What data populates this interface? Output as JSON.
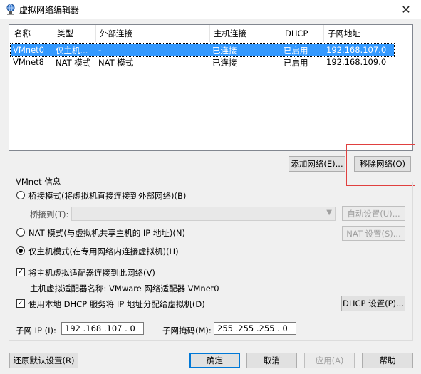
{
  "window": {
    "title": "虚拟网络编辑器",
    "icon": "vmware-network-icon",
    "close_glyph": "✕"
  },
  "table": {
    "columns": [
      "名称",
      "类型",
      "外部连接",
      "主机连接",
      "DHCP",
      "子网地址"
    ],
    "rows": [
      {
        "name": "VMnet0",
        "type": "仅主机...",
        "external": "-",
        "host": "已连接",
        "dhcp": "已启用",
        "subnet": "192.168.107.0",
        "selected": true
      },
      {
        "name": "VMnet8",
        "type": "NAT 模式",
        "external": "NAT 模式",
        "host": "已连接",
        "dhcp": "已启用",
        "subnet": "192.168.109.0",
        "selected": false
      }
    ]
  },
  "buttons": {
    "add_network": "添加网络(E)...",
    "remove_network": "移除网络(O)",
    "auto_settings": "自动设置(U)...",
    "nat_settings": "NAT 设置(S)...",
    "dhcp_settings": "DHCP 设置(P)...",
    "restore_defaults": "还原默认设置(R)",
    "ok": "确定",
    "cancel": "取消",
    "apply": "应用(A)",
    "help": "帮助"
  },
  "vmnet_info": {
    "group_label": "VMnet 信息",
    "bridged_label": "桥接模式(将虚拟机直接连接到外部网络)(B)",
    "bridged_to_label": "桥接到(T):",
    "bridged_to_value": "",
    "nat_label": "NAT 模式(与虚拟机共享主机的 IP 地址)(N)",
    "hostonly_label": "仅主机模式(在专用网络内连接虚拟机)(H)",
    "mode": "hostonly",
    "connect_adapter_label": "将主机虚拟适配器连接到此网络(V)",
    "connect_adapter_checked": true,
    "adapter_name_label": "主机虚拟适配器名称: VMware 网络适配器 VMnet0",
    "use_dhcp_label": "使用本地 DHCP 服务将 IP 地址分配给虚拟机(D)",
    "use_dhcp_checked": true,
    "subnet_ip_label": "子网 IP (I):",
    "subnet_ip_value": "192 .168 .107 . 0",
    "subnet_mask_label": "子网掩码(M):",
    "subnet_mask_value": "255 .255 .255 . 0"
  },
  "colors": {
    "selection": "#3399ff",
    "highlight_box": "#e0403f",
    "accent": "#0078d7"
  }
}
